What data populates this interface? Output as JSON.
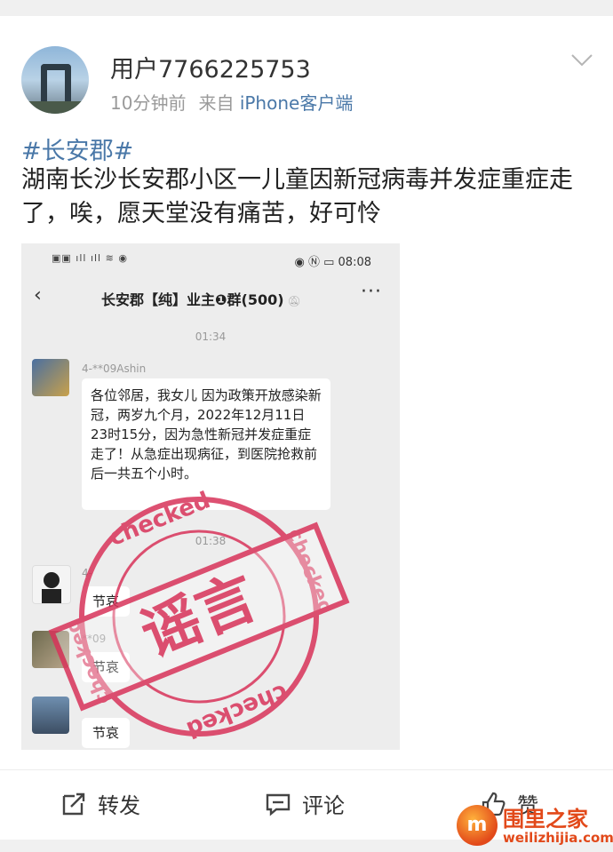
{
  "post": {
    "username": "用户7766225753",
    "time": "10分钟前",
    "source_prefix": "来自",
    "client": "iPhone客户端",
    "hashtag": "#长安郡#",
    "text": "湖南长沙长安郡小区一儿童因新冠病毒并发症重症走了，唉，愿天堂没有痛苦，好可怜"
  },
  "screenshot": {
    "status_time": "08:08",
    "chat_title": "长安郡【纯】业主❶群(500)",
    "times": [
      "01:34",
      "01:38"
    ],
    "messages": [
      {
        "sender": "4-**09Ashin",
        "text": "各位邻居，我女儿 因为政策开放感染新冠，两岁九个月，2022年12月11日23时15分，因为急性新冠并发症重症走了！从急症出现病征，到医院抢救前后一共五个小时。"
      },
      {
        "sender": "4-",
        "text": "节哀"
      },
      {
        "sender": "**09",
        "text": "节哀"
      },
      {
        "sender": "",
        "text": "节哀"
      }
    ],
    "stamp": {
      "label": "谣言",
      "ring_text": "checked",
      "color": "#d8335a"
    }
  },
  "actions": {
    "repost": "转发",
    "comment": "评论",
    "like": "赞"
  },
  "watermark": {
    "logo_char": "m",
    "name": "围里之家",
    "url": "weilizhijia.com"
  }
}
